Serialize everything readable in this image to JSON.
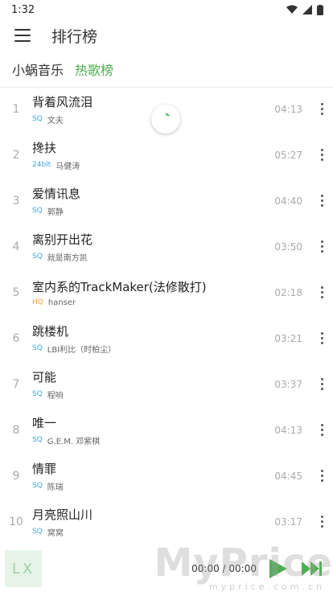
{
  "status": {
    "time": "1:32"
  },
  "header": {
    "title": "排行榜"
  },
  "tabs": [
    {
      "label": "小蜗音乐",
      "active": false
    },
    {
      "label": "热歌榜",
      "active": true
    }
  ],
  "songs": [
    {
      "index": "1",
      "title": "背着风流泪",
      "quality": "SQ",
      "artist": "文夫",
      "duration": "04:13"
    },
    {
      "index": "2",
      "title": "搀扶",
      "quality": "24bit",
      "artist": "马健涛",
      "duration": "05:27"
    },
    {
      "index": "3",
      "title": "爱情讯息",
      "quality": "SQ",
      "artist": "郭静",
      "duration": "04:40"
    },
    {
      "index": "4",
      "title": "离别开出花",
      "quality": "SQ",
      "artist": "就是南方凯",
      "duration": "03:50"
    },
    {
      "index": "5",
      "title": "室内系的TrackMaker(法修散打)",
      "quality": "HQ",
      "artist": "hanser",
      "duration": "02:18"
    },
    {
      "index": "6",
      "title": "跳楼机",
      "quality": "SQ",
      "artist": "LBI利比（时柏尘）",
      "duration": "03:21"
    },
    {
      "index": "7",
      "title": "可能",
      "quality": "SQ",
      "artist": "程响",
      "duration": "03:37"
    },
    {
      "index": "8",
      "title": "唯一",
      "quality": "SQ",
      "artist": "G.E.M. 邓紫棋",
      "duration": "04:13"
    },
    {
      "index": "9",
      "title": "情罪",
      "quality": "SQ",
      "artist": "陈瑞",
      "duration": "04:45"
    },
    {
      "index": "10",
      "title": "月亮照山川",
      "quality": "SQ",
      "artist": "窝窝",
      "duration": "03:17"
    }
  ],
  "player": {
    "cover_text": "LX",
    "time": "00:00 / 00:00"
  },
  "watermark": {
    "main": "MyPrice",
    "sub": "myprice.com.cn"
  }
}
